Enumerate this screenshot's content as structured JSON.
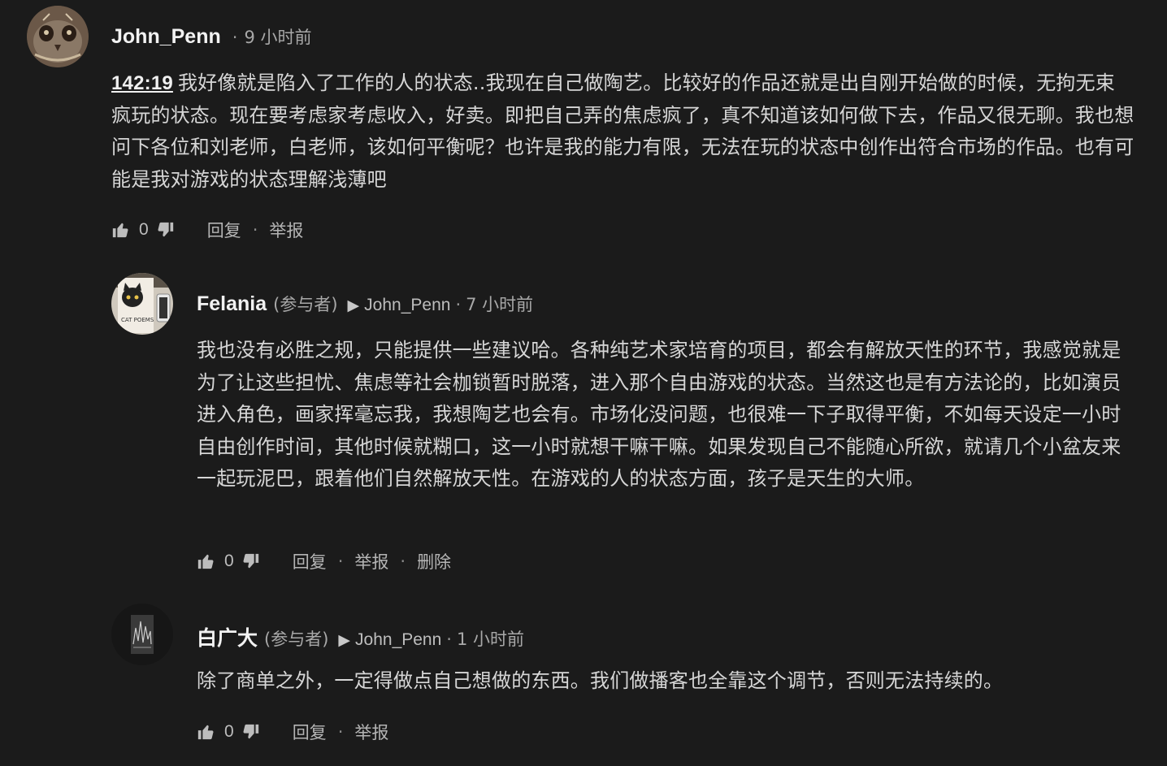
{
  "comments": [
    {
      "username": "John_Penn",
      "role": "",
      "reply_to": "",
      "dot": "·",
      "time": "9 小时前",
      "timestamp_link": "142:19",
      "body": "我好像就是陷入了工作的人的状态..我现在自己做陶艺。比较好的作品还就是出自刚开始做的时候，无拘无束 疯玩的状态。现在要考虑家考虑收入，好卖。即把自己弄的焦虑疯了，真不知道该如何做下去，作品又很无聊。我也想问下各位和刘老师，白老师，该如何平衡呢？也许是我的能力有限，无法在玩的状态中创作出符合市场的作品。也有可能是我对游戏的状态理解浅薄吧",
      "votes": "0",
      "actions": [
        "回复",
        "举报"
      ],
      "avatar_icon": "owl-face-avatar"
    },
    {
      "username": "Felania",
      "role": "(参与者)",
      "reply_arrow": "▶",
      "reply_to": "John_Penn",
      "dot": "·",
      "time": "7 小时前",
      "body": "我也没有必胜之规，只能提供一些建议哈。各种纯艺术家培育的项目，都会有解放天性的环节，我感觉就是为了让这些担忧、焦虑等社会枷锁暂时脱落，进入那个自由游戏的状态。当然这也是有方法论的，比如演员进入角色，画家挥毫忘我，我想陶艺也会有。市场化没问题，也很难一下子取得平衡，不如每天设定一小时自由创作时间，其他时候就糊口，这一小时就想干嘛干嘛。如果发现自己不能随心所欲，就请几个小盆友来一起玩泥巴，跟着他们自然解放天性。在游戏的人的状态方面，孩子是天生的大师。",
      "votes": "0",
      "actions": [
        "回复",
        "举报",
        "删除"
      ],
      "avatar_icon": "cat-poems-book-avatar",
      "avatar_text": "CAT POEMS"
    },
    {
      "username": "白广大",
      "role": "(参与者)",
      "reply_arrow": "▶",
      "reply_to": "John_Penn",
      "dot": "·",
      "time": "1 小时前",
      "body": "除了商单之外，一定得做点自己想做的东西。我们做播客也全靠这个调节，否则无法持续的。",
      "votes": "0",
      "actions": [
        "回复",
        "举报"
      ],
      "avatar_icon": "album-cover-avatar"
    }
  ],
  "separator": "·",
  "colors": {
    "background": "#1b1b1b",
    "text": "#d6d6d6",
    "muted": "#a8a8a8"
  }
}
